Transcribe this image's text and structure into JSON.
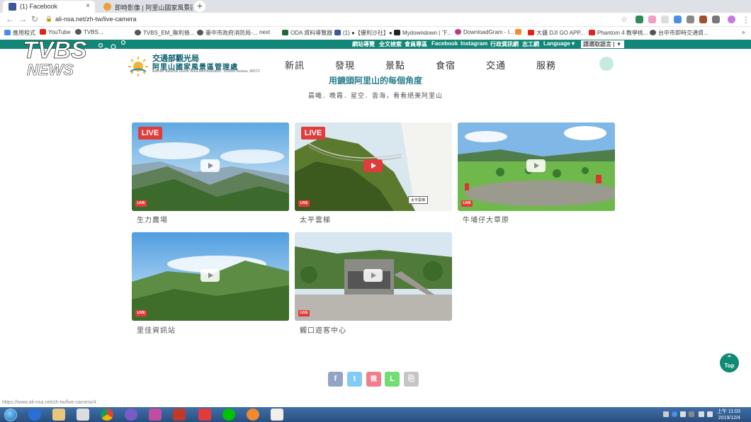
{
  "browser": {
    "tabs": [
      {
        "label": "(1) Facebook",
        "active": true,
        "favicon_color": "#3b5998"
      },
      {
        "label": "即時影像 | 阿里山國家風景區",
        "active": false,
        "favicon_color": "#e8a23c"
      }
    ],
    "new_tab": "+",
    "close_tab": "×",
    "url": "ali-nsa.net/zh-tw/live-camera",
    "bookmarks": [
      {
        "label": "應用程式",
        "color": "#4a8af4"
      },
      {
        "label": "YouTube",
        "color": "#e62117"
      },
      {
        "label": "TVBS...",
        "color": "#555555"
      },
      {
        "label": "TVBS_EM_聯利條...",
        "color": "#555555"
      },
      {
        "label": "臺中市政府消防局-...",
        "color": "#555555"
      },
      {
        "label": "next",
        "color": "#888888"
      },
      {
        "label": "ODA 資料導覽器",
        "color": "#1e6a3a"
      },
      {
        "label": "(1) ●【優利沙社】●",
        "color": "#3b5998"
      },
      {
        "label": "Mydowndown | 下...",
        "color": "#222222"
      },
      {
        "label": "DownloadGram - I...",
        "color": "#c13584"
      },
      {
        "label": "",
        "color": "#f48c2c"
      },
      {
        "label": "大疆 DJI GO APP...",
        "color": "#e62117"
      },
      {
        "label": "Phantom 4 教學桃...",
        "color": "#e62117"
      },
      {
        "label": "台中市即時交通資...",
        "color": "#555555"
      }
    ]
  },
  "site": {
    "top_links": [
      "網站導覽",
      "全文檢索",
      "會員專區",
      "Facebook",
      "Instagram",
      "行政資訊網",
      "志工網",
      "Language ▾",
      "請選取語言 | ▼"
    ],
    "logo": {
      "line1": "交通部觀光局",
      "line2": "阿里山國家風景區管理處",
      "line3": "Alishan National Scenic Area Administration, Tourism Bureau, MOTC"
    },
    "main_nav": [
      "新訊",
      "發現",
      "景點",
      "食宿",
      "交通",
      "服務"
    ],
    "section_title": "用鏡頭阿里山的每個角度",
    "section_subtitle": "晨曦．晚霞．星空．雲海，看看絕美阿里山"
  },
  "cameras": [
    {
      "name": "生力農場",
      "live_badge": "LIVE",
      "small_badge": "LIVE",
      "show_big_badge": true,
      "hovered": false
    },
    {
      "name": "太平雲梯",
      "live_badge": "LIVE",
      "small_badge": "LIVE",
      "show_big_badge": true,
      "hovered": true,
      "overlay": "太平雲梯"
    },
    {
      "name": "牛埔仔大草原",
      "small_badge": "LIVE",
      "show_big_badge": false,
      "hovered": false
    },
    {
      "name": "里佳資訊站",
      "small_badge": "LIVE",
      "show_big_badge": false,
      "hovered": false
    },
    {
      "name": "觸口遊客中心",
      "small_badge": "LIVE",
      "show_big_badge": false,
      "hovered": false
    }
  ],
  "share_buttons": [
    {
      "icon": "facebook-icon",
      "glyph": "f",
      "color": "#3b5998"
    },
    {
      "icon": "twitter-icon",
      "glyph": "t",
      "color": "#1da1f2"
    },
    {
      "icon": "weibo-icon",
      "glyph": "微",
      "color": "#e6162d"
    },
    {
      "icon": "line-icon",
      "glyph": "L",
      "color": "#00c300"
    },
    {
      "icon": "copy-icon",
      "glyph": "⎘",
      "color": "#999999"
    }
  ],
  "back_to_top": "Top",
  "status_url": "https://www.ali-nsa.net/zh-tw/live-camera/4",
  "watermark": "TVBS NEWS",
  "taskbar": {
    "time": "上午 11:03",
    "date": "2019/12/4"
  }
}
